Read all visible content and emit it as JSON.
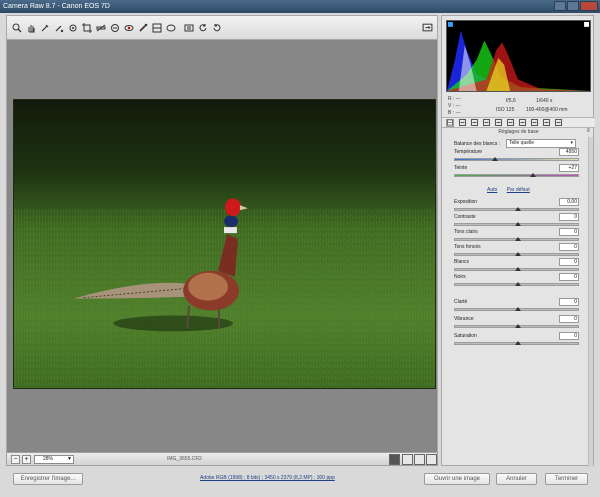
{
  "window": {
    "title": "Camera Raw 8.7  -  Canon EOS 7D"
  },
  "toolbar": {
    "tools": [
      "zoom-icon",
      "hand-icon",
      "white-balance-icon",
      "color-sampler-icon",
      "targeted-adjustment-icon",
      "crop-icon",
      "straighten-icon",
      "spot-removal-icon",
      "red-eye-icon",
      "adjustment-brush-icon",
      "graduated-filter-icon",
      "radial-filter-icon",
      "preferences-icon",
      "rotate-ccw-icon",
      "rotate-cw-icon"
    ]
  },
  "status": {
    "zoom_value": "28%",
    "filename": "IMG_3655.CR2"
  },
  "camera_info": {
    "r_label": "R :",
    "r_value": "---",
    "v_label": "V :",
    "v_value": "---",
    "b_label": "B :",
    "b_value": "---",
    "aperture": "f/5,6",
    "shutter": "1/640 s",
    "iso": "ISO 125",
    "lens": "100-400@400 mm"
  },
  "panel": {
    "heading": "Réglages de base",
    "tabs": [
      "basic-tab-icon",
      "tone-curve-tab-icon",
      "detail-tab-icon",
      "hsl-tab-icon",
      "split-toning-tab-icon",
      "lens-tab-icon",
      "effects-tab-icon",
      "camera-calibration-tab-icon",
      "presets-tab-icon",
      "snapshots-tab-icon"
    ],
    "wb_label": "Balance des blancs :",
    "wb_value": "Telle quelle",
    "auto_label": "Auto",
    "default_label": "Par défaut",
    "sliders": [
      {
        "label": "Température",
        "value": "4950",
        "pos": 0.32
      },
      {
        "label": "Teinte",
        "value": "+27",
        "pos": 0.62
      },
      {
        "label": "Exposition",
        "value": "0,00",
        "pos": 0.5
      },
      {
        "label": "Contraste",
        "value": "0",
        "pos": 0.5
      },
      {
        "label": "Tons clairs",
        "value": "0",
        "pos": 0.5
      },
      {
        "label": "Tons foncés",
        "value": "0",
        "pos": 0.5
      },
      {
        "label": "Blancs",
        "value": "0",
        "pos": 0.5
      },
      {
        "label": "Noirs",
        "value": "0",
        "pos": 0.5
      },
      {
        "label": "Clarté",
        "value": "0",
        "pos": 0.5
      },
      {
        "label": "Vibrance",
        "value": "0",
        "pos": 0.5
      },
      {
        "label": "Saturation",
        "value": "0",
        "pos": 0.5
      }
    ]
  },
  "footer": {
    "save_label": "Enregistrer l'image...",
    "workflow_text": "Adobe RGB (1998) ; 8 bits) ; 3450 x 2379 (8,2 MP) ; 300 ppp",
    "open_label": "Ouvrir une image",
    "cancel_label": "Annuler",
    "done_label": "Terminer"
  }
}
